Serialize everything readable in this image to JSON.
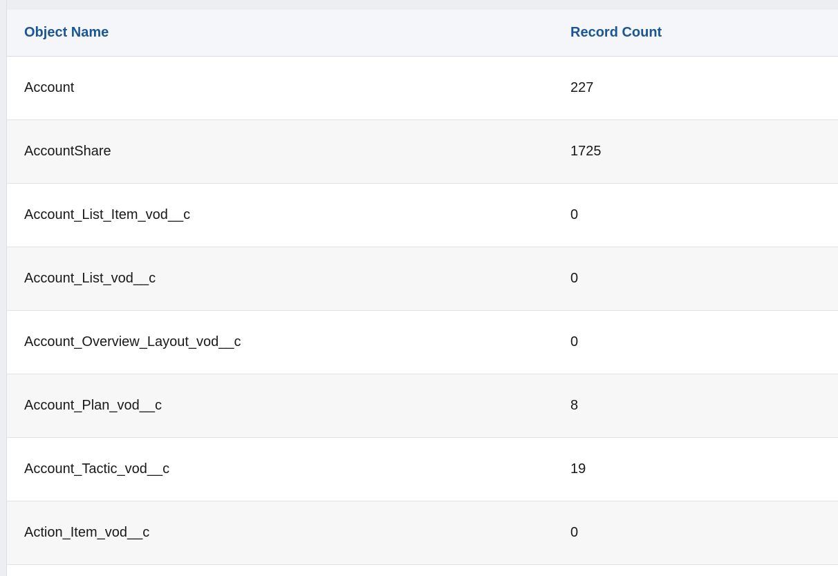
{
  "table": {
    "headers": {
      "name": "Object Name",
      "count": "Record Count"
    },
    "rows": [
      {
        "name": "Account",
        "count": "227"
      },
      {
        "name": "AccountShare",
        "count": "1725"
      },
      {
        "name": "Account_List_Item_vod__c",
        "count": "0"
      },
      {
        "name": "Account_List_vod__c",
        "count": "0"
      },
      {
        "name": "Account_Overview_Layout_vod__c",
        "count": "0"
      },
      {
        "name": "Account_Plan_vod__c",
        "count": "8"
      },
      {
        "name": "Account_Tactic_vod__c",
        "count": "19"
      },
      {
        "name": "Action_Item_vod__c",
        "count": "0"
      }
    ]
  },
  "colors": {
    "header_text": "#1c5594",
    "header_bg": "#f4f6f9",
    "row_alt_bg": "#f7f7f8",
    "border": "#dfe3e8"
  }
}
